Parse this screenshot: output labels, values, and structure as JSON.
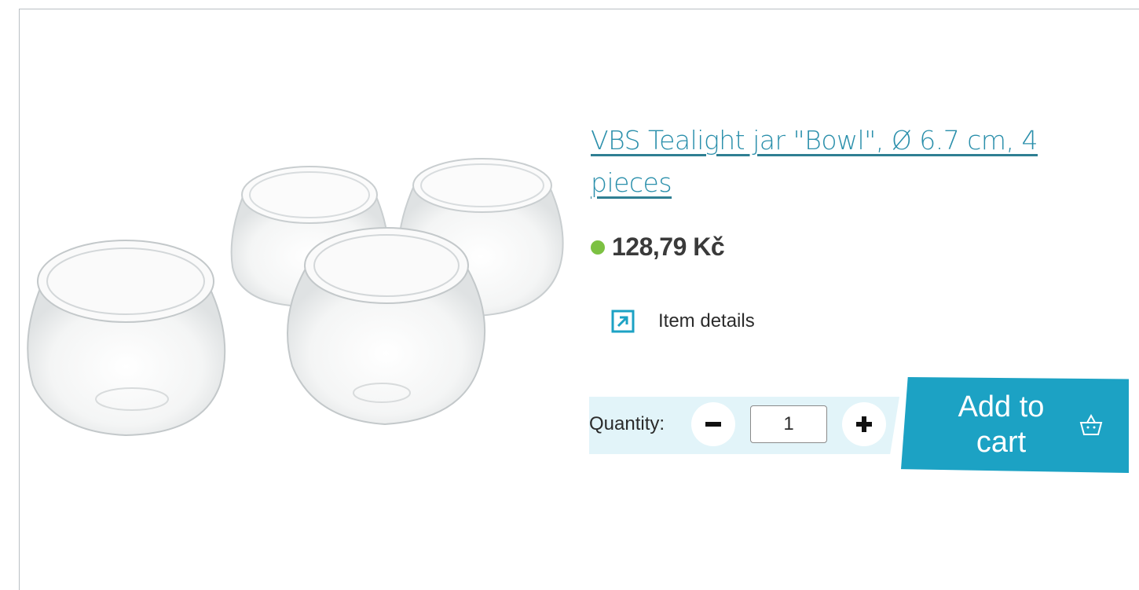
{
  "product": {
    "title": "VBS Tealight jar \"Bowl\", Ø 6.7 cm, 4 pieces",
    "image_alt": "Four round glass tealight jars",
    "price": "128,79 Kč",
    "stock_status_color": "#7cc142"
  },
  "details": {
    "label": "Item details",
    "icon": "external-arrow-icon"
  },
  "quantity": {
    "label": "Quantity:",
    "value": "1",
    "minus_icon": "minus-icon",
    "plus_icon": "plus-icon"
  },
  "cart": {
    "label": "Add to cart",
    "icon": "basket-icon"
  },
  "colors": {
    "accent": "#1ca2c4",
    "title_link": "#2a8fab",
    "quantity_bg": "#e2f4f9"
  }
}
